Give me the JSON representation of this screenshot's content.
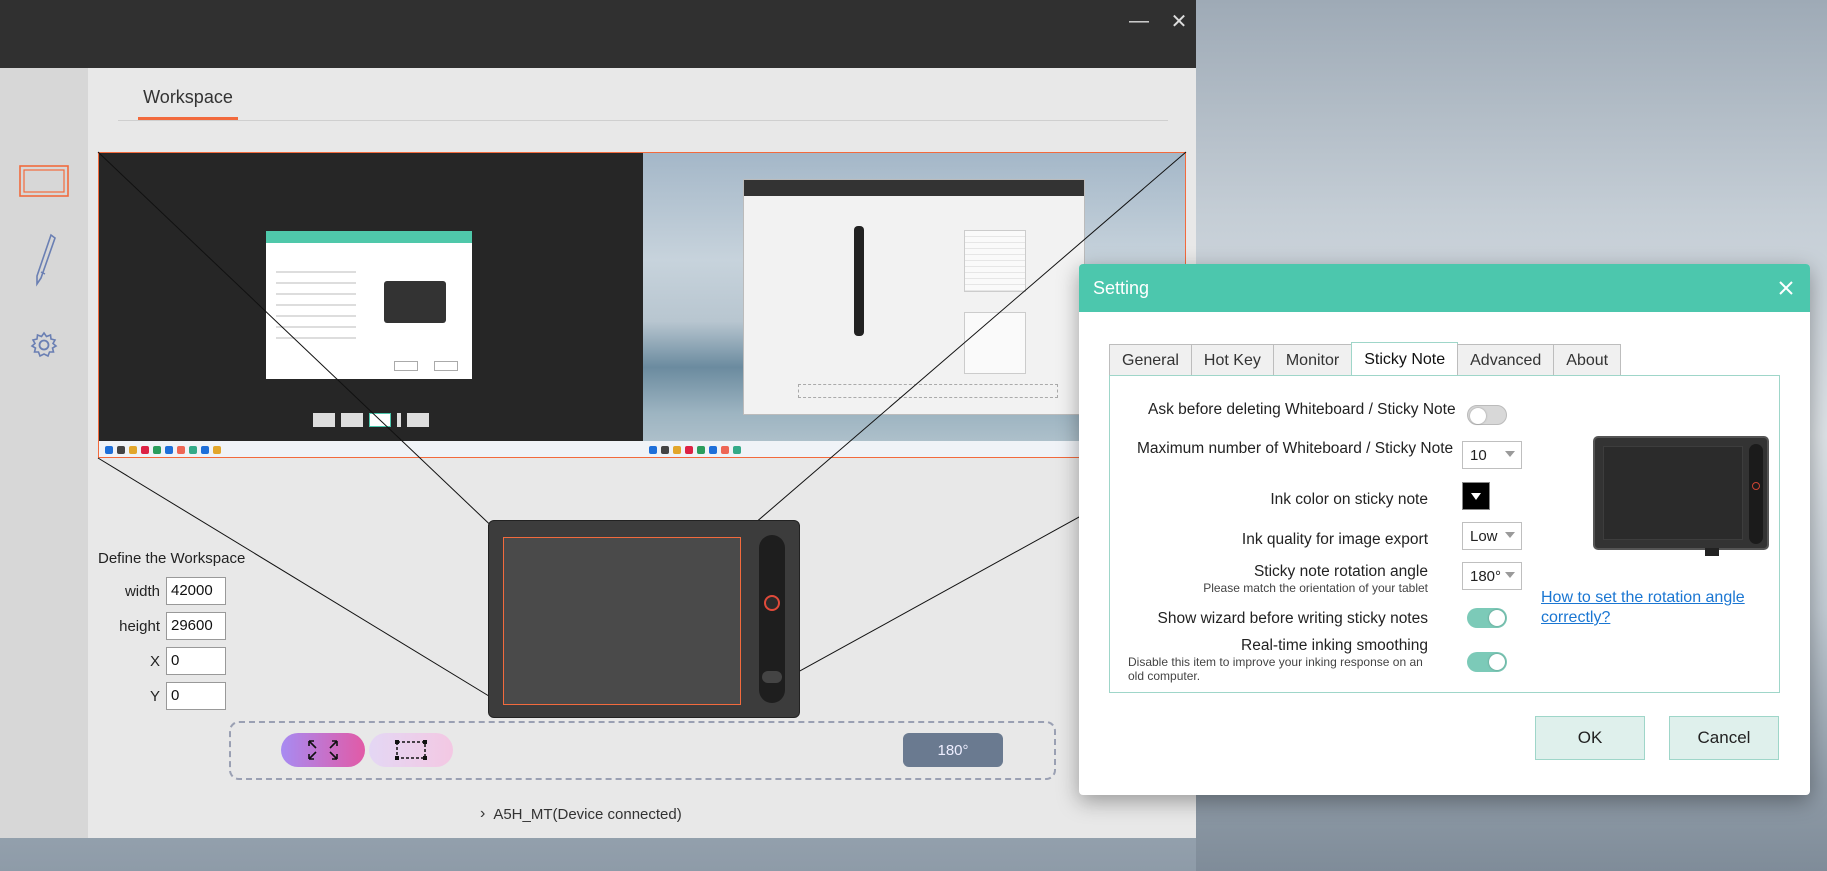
{
  "window": {
    "minimize_glyph": "—",
    "close_glyph": "✕"
  },
  "sidebar": {
    "items": [
      {
        "name": "workspace-icon"
      },
      {
        "name": "pen-icon"
      },
      {
        "name": "gear-icon"
      }
    ]
  },
  "workspace": {
    "tab_label": "Workspace",
    "define_title": "Define the Workspace",
    "fields": [
      {
        "label": "width",
        "value": "42000"
      },
      {
        "label": "height",
        "value": "29600"
      },
      {
        "label": "X",
        "value": "0"
      },
      {
        "label": "Y",
        "value": "0"
      }
    ],
    "rotation_button": "180°",
    "device_status": "A5H_MT(Device connected)"
  },
  "setting_dialog": {
    "title": "Setting",
    "tabs": [
      "General",
      "Hot Key",
      "Monitor",
      "Sticky Note",
      "Advanced",
      "About"
    ],
    "active_tab": "Sticky Note",
    "options": {
      "ask_delete_label": "Ask before deleting Whiteboard / Sticky Note",
      "ask_delete_on": false,
      "max_number_label": "Maximum number of Whiteboard / Sticky Note",
      "max_number_value": "10",
      "ink_color_label": "Ink color on sticky note",
      "ink_color_value": "#000000",
      "ink_quality_label": "Ink quality for image export",
      "ink_quality_value": "Low",
      "rotation_label": "Sticky note rotation angle",
      "rotation_sub": "Please match the orientation of your tablet",
      "rotation_value": "180°",
      "wizard_label": "Show wizard before writing sticky notes",
      "wizard_on": true,
      "smoothing_label": "Real-time inking smoothing",
      "smoothing_sub": "Disable this item to improve your inking response on an old computer.",
      "smoothing_on": true
    },
    "help_link": "How to set the rotation angle correctly?",
    "ok_label": "OK",
    "cancel_label": "Cancel"
  },
  "colors": {
    "accent_orange": "#f26a3d",
    "dialog_teal": "#4cc7ad",
    "toggle_on": "#7ccab8",
    "link_blue": "#1a76d2"
  }
}
